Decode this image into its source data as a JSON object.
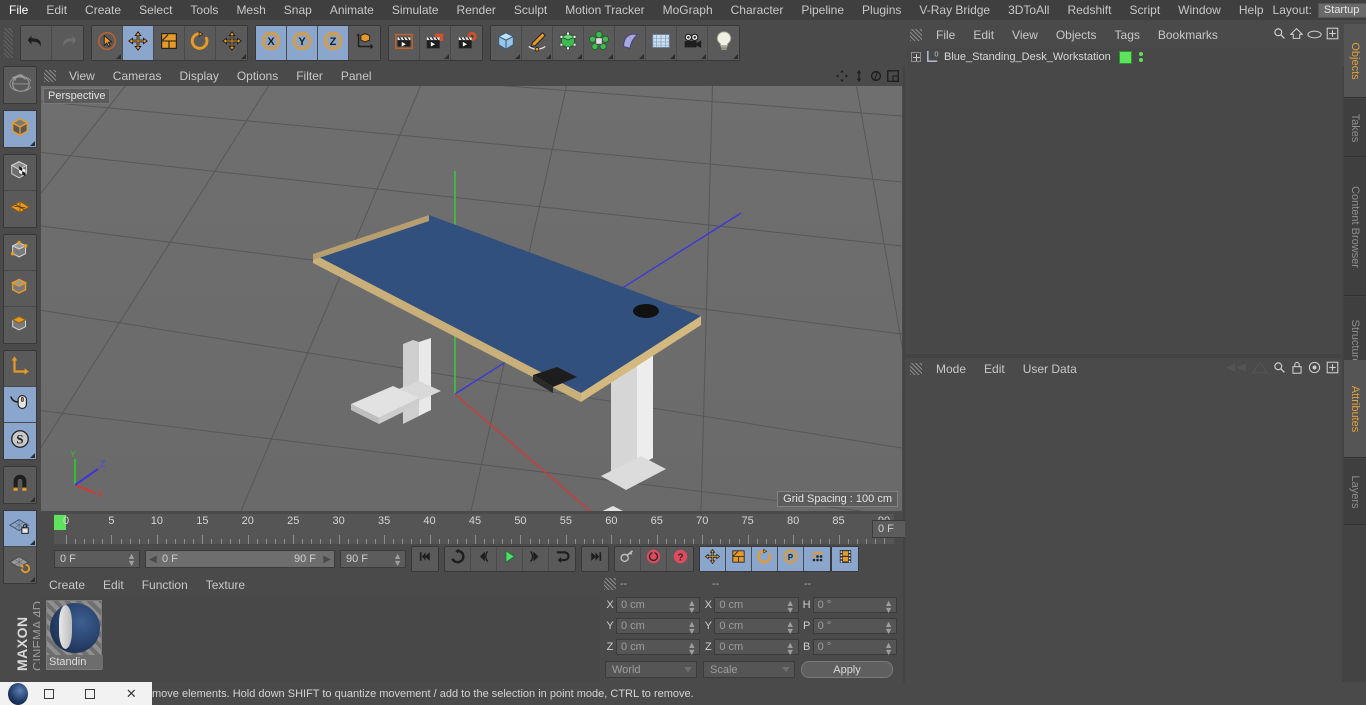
{
  "menubar": {
    "items": [
      "File",
      "Edit",
      "Create",
      "Select",
      "Tools",
      "Mesh",
      "Snap",
      "Animate",
      "Simulate",
      "Render",
      "Sculpt",
      "Motion Tracker",
      "MoGraph",
      "Character",
      "Pipeline",
      "Plugins",
      "V-Ray Bridge",
      "3DToAll",
      "Redshift",
      "Script",
      "Window",
      "Help"
    ],
    "layout_label": "Layout:",
    "layout_value": "Startup",
    "search_icon": "magnifier-icon"
  },
  "toolbar": {
    "groups": [
      {
        "name": "history",
        "buttons": [
          {
            "name": "undo",
            "icon": "undo-arrow-icon",
            "selected": false,
            "menu": false
          },
          {
            "name": "redo",
            "icon": "redo-arrow-icon",
            "selected": false,
            "menu": false
          }
        ]
      },
      {
        "name": "transform",
        "buttons": [
          {
            "name": "live-selection",
            "icon": "cursor-circle-icon",
            "selected": false,
            "menu": true
          },
          {
            "name": "move",
            "icon": "move-arrows-icon",
            "selected": true,
            "menu": false
          },
          {
            "name": "scale",
            "icon": "scale-box-icon",
            "selected": false,
            "menu": false
          },
          {
            "name": "rotate",
            "icon": "rotate-arc-icon",
            "selected": false,
            "menu": false
          },
          {
            "name": "move-dynamic",
            "icon": "move-arrows-icon",
            "selected": false,
            "menu": true
          }
        ]
      },
      {
        "name": "axis-lock",
        "buttons": [
          {
            "name": "lock-x",
            "icon": "x-axis-icon",
            "label": "X",
            "selected": true,
            "menu": false
          },
          {
            "name": "lock-y",
            "icon": "y-axis-icon",
            "label": "Y",
            "selected": true,
            "menu": false
          },
          {
            "name": "lock-z",
            "icon": "z-axis-icon",
            "label": "Z",
            "selected": true,
            "menu": false
          },
          {
            "name": "world-object-coordinates",
            "icon": "world-axis-cube-icon",
            "selected": false,
            "menu": false
          }
        ]
      },
      {
        "name": "render",
        "buttons": [
          {
            "name": "render-view",
            "icon": "clapperboard-icon",
            "selected": false,
            "menu": false
          },
          {
            "name": "render-to-picture-viewer",
            "icon": "clapperboard-picture-icon",
            "selected": false,
            "menu": true
          },
          {
            "name": "edit-render-settings",
            "icon": "clapperboard-gear-icon",
            "selected": false,
            "menu": false
          }
        ]
      },
      {
        "name": "create",
        "buttons": [
          {
            "name": "add-cube-object",
            "icon": "cube-icon",
            "selected": false,
            "menu": true
          },
          {
            "name": "add-spline",
            "icon": "pen-spline-icon",
            "selected": false,
            "menu": true
          },
          {
            "name": "add-generator",
            "icon": "green-cube-generator-icon",
            "selected": false,
            "menu": true
          },
          {
            "name": "add-array-modifier",
            "icon": "green-cluster-icon",
            "selected": false,
            "menu": true
          },
          {
            "name": "add-deformer",
            "icon": "bend-deformer-icon",
            "selected": false,
            "menu": true
          },
          {
            "name": "add-environment",
            "icon": "floor-grid-icon",
            "selected": false,
            "menu": true
          },
          {
            "name": "add-camera",
            "icon": "camera-icon",
            "selected": false,
            "menu": true
          },
          {
            "name": "add-light",
            "icon": "lightbulb-icon",
            "selected": false,
            "menu": true
          }
        ]
      }
    ]
  },
  "left_toolbar": {
    "groups": [
      {
        "name": "undo-view",
        "buttons": [
          {
            "name": "undo-view",
            "icon": "globe-undo-icon",
            "selected": false,
            "menu": false
          }
        ]
      },
      {
        "name": "mode-objects",
        "buttons": [
          {
            "name": "object-mode",
            "icon": "cube-orange-icon",
            "selected": true,
            "menu": true
          }
        ]
      },
      {
        "name": "mode-texture",
        "buttons": [
          {
            "name": "texture-mode",
            "icon": "checkered-cube-icon",
            "selected": false,
            "menu": false
          },
          {
            "name": "workplane-mode",
            "icon": "orange-grid-plane-icon",
            "selected": false,
            "menu": false
          }
        ]
      },
      {
        "name": "mode-components",
        "buttons": [
          {
            "name": "point-mode",
            "icon": "cube-points-icon",
            "selected": false,
            "menu": false
          },
          {
            "name": "edge-mode",
            "icon": "cube-edges-icon",
            "selected": false,
            "menu": false
          },
          {
            "name": "polygon-mode",
            "icon": "cube-polygon-icon",
            "selected": false,
            "menu": false
          }
        ]
      },
      {
        "name": "axis-and-snapping",
        "buttons": [
          {
            "name": "enable-axis-modification",
            "icon": "axis-L-icon",
            "selected": false,
            "menu": false
          },
          {
            "name": "viewport-solo-single",
            "icon": "mouse-icon",
            "selected": true,
            "menu": false
          },
          {
            "name": "soft-selection",
            "icon": "s-circle-icon",
            "selected": true,
            "menu": true
          }
        ]
      },
      {
        "name": "magnet",
        "buttons": [
          {
            "name": "magnet-tool",
            "icon": "magnet-icon",
            "selected": false,
            "menu": true
          }
        ]
      },
      {
        "name": "workplane",
        "buttons": [
          {
            "name": "lock-workplane",
            "icon": "grid-lock-icon",
            "selected": true,
            "menu": true
          },
          {
            "name": "planar-workplane",
            "icon": "grid-rotate-icon",
            "selected": false,
            "menu": true
          }
        ]
      }
    ],
    "brand_top": "MAXON",
    "brand_bottom": "CINEMA 4D"
  },
  "viewport": {
    "menu": [
      "View",
      "Cameras",
      "Display",
      "Options",
      "Filter",
      "Panel"
    ],
    "camera_label": "Perspective",
    "grid_spacing": "Grid Spacing : 100 cm",
    "corner_icons": [
      "pan-view-icon",
      "zoom-view-icon",
      "rotate-view-icon",
      "maximize-view-icon"
    ],
    "axis_gizmo": {
      "x": "X",
      "y": "Y",
      "z": "Z"
    },
    "scene_object": "blue-standing-desk"
  },
  "timeline": {
    "ruler_labels": [
      0,
      5,
      10,
      15,
      20,
      25,
      30,
      35,
      40,
      45,
      50,
      55,
      60,
      65,
      70,
      75,
      80,
      85,
      90
    ],
    "current_frame": "0 F",
    "range_start": "0 F",
    "range_end": "90 F",
    "end_frame_field": "90 F",
    "frame_field_right": "0 F",
    "playhead_frame": 0,
    "transport": [
      {
        "name": "go-to-start",
        "icon": "skip-start-icon",
        "selected": false
      },
      {
        "name": "play-backwards-loop",
        "icon": "loop-back-icon",
        "selected": false
      },
      {
        "name": "step-back",
        "icon": "step-back-icon",
        "selected": false
      },
      {
        "name": "play-forward",
        "icon": "play-icon",
        "selected": false
      },
      {
        "name": "step-forward",
        "icon": "step-forward-icon",
        "selected": false
      },
      {
        "name": "play-loop",
        "icon": "loop-forward-icon",
        "selected": false
      },
      {
        "name": "go-to-end",
        "icon": "skip-end-icon",
        "selected": false
      }
    ],
    "keys": [
      {
        "name": "autokeying",
        "icon": "key-icon",
        "selected": false
      },
      {
        "name": "record-active-objects",
        "icon": "record-red-icon",
        "selected": false
      },
      {
        "name": "keyframe-selection",
        "icon": "question-red-icon",
        "selected": false
      }
    ],
    "key_flags": [
      {
        "name": "key-position",
        "icon": "move-arrows-icon",
        "selected": true
      },
      {
        "name": "key-scale",
        "icon": "scale-box-icon",
        "selected": true
      },
      {
        "name": "key-rotation",
        "icon": "rotate-arc-icon",
        "selected": true
      },
      {
        "name": "key-parameter",
        "icon": "p-circle-icon",
        "selected": true
      },
      {
        "name": "key-point-level-animation",
        "icon": "dots-grid-icon",
        "selected": true
      },
      {
        "name": "timeline-filmstrip",
        "icon": "filmstrip-icon",
        "selected": true
      }
    ]
  },
  "material_manager": {
    "menu": [
      "Create",
      "Edit",
      "Function",
      "Texture"
    ],
    "materials": [
      {
        "name": "Standin",
        "swatch": "blue-sphere-preview"
      }
    ]
  },
  "coordinates": {
    "header": [
      "--",
      "--",
      "--"
    ],
    "rows": [
      {
        "pos_label": "X",
        "pos_value": "0 cm",
        "size_label": "X",
        "size_value": "0 cm",
        "rot_label": "H",
        "rot_value": "0 °"
      },
      {
        "pos_label": "Y",
        "pos_value": "0 cm",
        "size_label": "Y",
        "size_value": "0 cm",
        "rot_label": "P",
        "rot_value": "0 °"
      },
      {
        "pos_label": "Z",
        "pos_value": "0 cm",
        "size_label": "Z",
        "size_value": "0 cm",
        "rot_label": "B",
        "rot_value": "0 °"
      }
    ],
    "system": "World",
    "mode": "Scale",
    "apply": "Apply"
  },
  "object_manager": {
    "menu": [
      "File",
      "Edit",
      "View",
      "Objects",
      "Tags",
      "Bookmarks"
    ],
    "icons": [
      "search-icon",
      "home-icon",
      "eye-icon",
      "add-layer-icon"
    ],
    "objects": [
      {
        "name": "Blue_Standing_Desk_Workstation",
        "icon": "null-object-icon",
        "layer_badge": "0",
        "tag": "green-layer-tag"
      }
    ]
  },
  "attribute_manager": {
    "menu": [
      "Mode",
      "Edit",
      "User Data"
    ],
    "icons": [
      "prev-nav-icon",
      "next-nav-icon",
      "search-icon",
      "lock-icon",
      "target-icon",
      "add-tab-icon"
    ]
  },
  "dock_tabs_top": [
    {
      "label": "Objects",
      "active": true
    },
    {
      "label": "Takes",
      "active": false
    },
    {
      "label": "Content Browser",
      "active": false
    },
    {
      "label": "Structure",
      "active": false
    }
  ],
  "dock_tabs_bottom": [
    {
      "label": "Attributes",
      "active": true
    },
    {
      "label": "Layers",
      "active": false
    }
  ],
  "statusbar": {
    "message": "move elements. Hold down SHIFT to quantize movement / add to the selection in point mode, CTRL to remove."
  },
  "window_controls": {
    "logo": "app-logo-icon",
    "restore": "restore-window-icon",
    "close": "close-window-icon"
  },
  "colors": {
    "accent_orange": "#e79a28",
    "selection_blue": "#8aa6cc",
    "panel_bg": "#4a4a4a",
    "viewport_bg": "#6b6b6b",
    "desk_top": "#31507d",
    "desk_edge": "#c9b07a",
    "green_tag": "#5ee35e"
  }
}
